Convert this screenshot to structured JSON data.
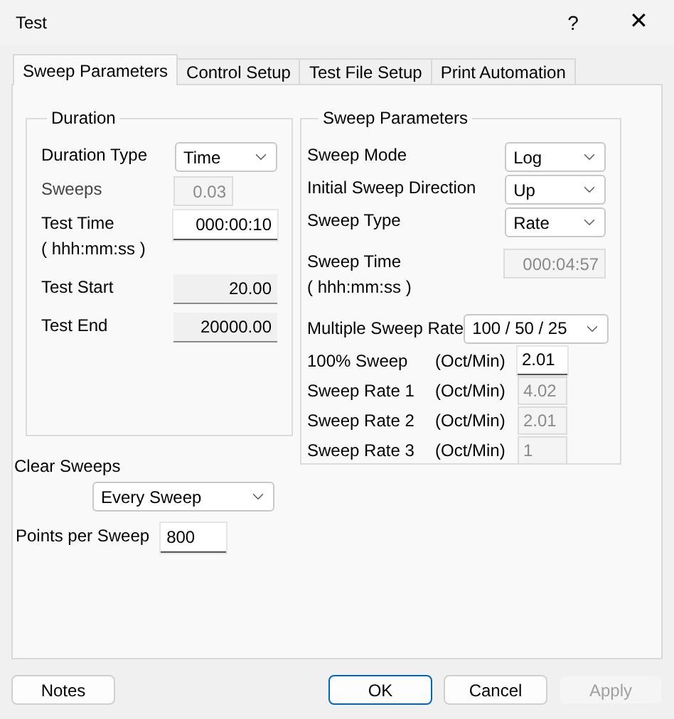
{
  "window": {
    "title": "Test",
    "help": "?",
    "close": "✕"
  },
  "tabs": [
    {
      "label": "Sweep Parameters",
      "selected": true
    },
    {
      "label": "Control Setup",
      "selected": false
    },
    {
      "label": "Test File Setup",
      "selected": false
    },
    {
      "label": "Print Automation",
      "selected": false
    }
  ],
  "duration": {
    "title": "Duration",
    "fields": [
      {
        "label": "Duration Type",
        "kind": "select",
        "value": "Time",
        "disabled": false
      },
      {
        "label": "Sweeps",
        "kind": "text",
        "value": "0.03",
        "disabled": true
      },
      {
        "label": "Test Time",
        "sublabel": "( hhh:mm:ss )",
        "kind": "text",
        "value": "000:00:10",
        "disabled": false,
        "readonly": false
      },
      {
        "label": "Test Start",
        "kind": "text",
        "value": "20.00",
        "disabled": false,
        "readonly": true
      },
      {
        "label": "Test End",
        "kind": "text",
        "value": "20000.00",
        "disabled": false,
        "readonly": true
      }
    ]
  },
  "clear_sweeps": {
    "label": "Clear Sweeps",
    "value": "Every Sweep"
  },
  "points_per_sweep": {
    "label": "Points per Sweep",
    "value": "800"
  },
  "sweep_parameters": {
    "title": "Sweep Parameters",
    "fields": [
      {
        "label": "Sweep Mode",
        "kind": "select",
        "value": "Log",
        "disabled": false
      },
      {
        "label": "Initial Sweep Direction",
        "kind": "select",
        "value": "Up",
        "disabled": false
      },
      {
        "label": "Sweep Type",
        "kind": "select",
        "value": "Rate",
        "disabled": false
      },
      {
        "label": "Sweep Time",
        "sublabel": "( hhh:mm:ss )",
        "kind": "text",
        "value": "000:04:57",
        "disabled": true
      }
    ],
    "multiple_sweep_rate": {
      "label": "Multiple Sweep Rate",
      "value": "100 / 50 / 25"
    },
    "rates": [
      {
        "label": "100% Sweep",
        "unit": "(Oct/Min)",
        "value": "2.01",
        "disabled": false
      },
      {
        "label": "Sweep Rate 1",
        "unit": "(Oct/Min)",
        "value": "4.02",
        "disabled": true
      },
      {
        "label": "Sweep Rate 2",
        "unit": "(Oct/Min)",
        "value": "2.01",
        "disabled": true
      },
      {
        "label": "Sweep Rate 3",
        "unit": "(Oct/Min)",
        "value": "1",
        "disabled": true
      }
    ]
  },
  "buttons": [
    {
      "label": "Notes",
      "kind": "left",
      "disabled": false,
      "default": false
    },
    {
      "label": "OK",
      "kind": "right",
      "disabled": false,
      "default": true
    },
    {
      "label": "Cancel",
      "kind": "right",
      "disabled": false,
      "default": false
    },
    {
      "label": "Apply",
      "kind": "right",
      "disabled": true
    }
  ]
}
